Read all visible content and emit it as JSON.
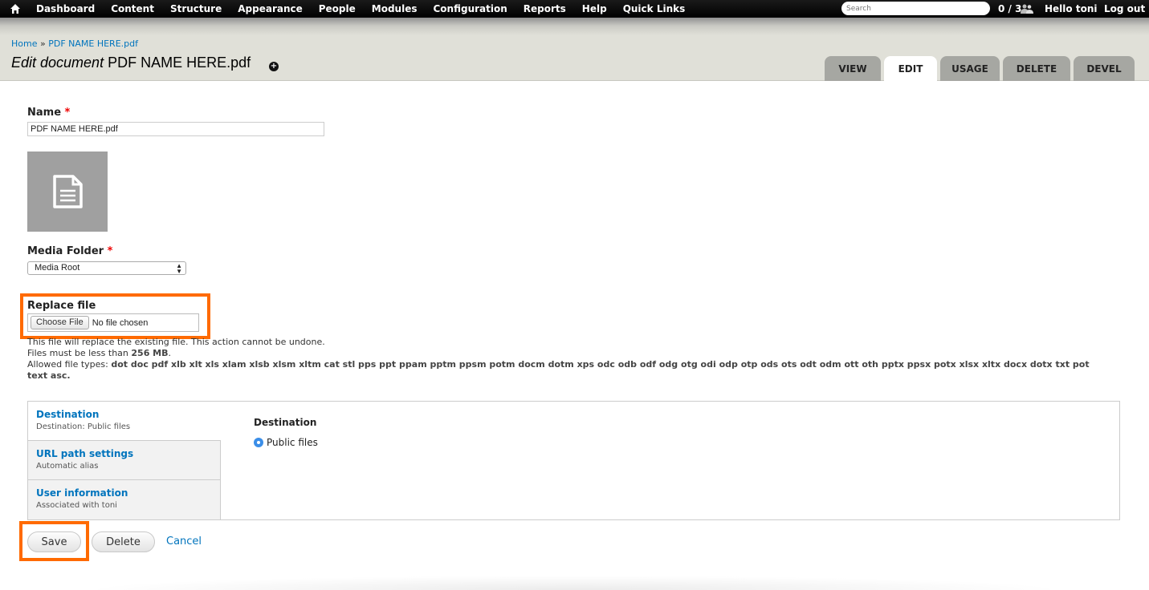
{
  "toolbar": {
    "menu": [
      "Dashboard",
      "Content",
      "Structure",
      "Appearance",
      "People",
      "Modules",
      "Configuration",
      "Reports",
      "Help",
      "Quick Links"
    ],
    "search_placeholder": "Search",
    "user_count": "0 / 3",
    "greeting": "Hello ",
    "username": "toni",
    "logout": "Log out"
  },
  "header": {
    "breadcrumb": {
      "home": "Home",
      "sep": " » ",
      "current": "PDF NAME HERE.pdf"
    },
    "title_prefix": "Edit document",
    "title_name": " PDF NAME HERE.pdf",
    "tabs": [
      "VIEW",
      "EDIT",
      "USAGE",
      "DELETE",
      "DEVEL"
    ],
    "active_tab": "EDIT"
  },
  "form": {
    "name_label": "Name",
    "required_mark": "*",
    "name_value": "PDF NAME HERE.pdf",
    "media_folder_label": "Media Folder",
    "media_folder_value": "Media Root",
    "replace_file_label": "Replace file",
    "choose_file_button": "Choose File",
    "no_file_text": "No file chosen",
    "desc_line1": "This file will replace the existing file. This action cannot be undone.",
    "desc_line2_prefix": "Files must be less than ",
    "desc_line2_size": "256 MB",
    "desc_line2_suffix": ".",
    "desc_line3_prefix": "Allowed file types: ",
    "allowed_types": "dot doc pdf xlb xlt xls xlam xlsb xlsm xltm cat stl pps ppt ppam pptm ppsm potm docm dotm xps odc odb odf odg otg odi odp otp ods ots odt odm ott oth pptx ppsx potx xlsx xltx docx dotx txt pot text asc",
    "desc_line3_suffix": "."
  },
  "vertical_tabs": {
    "items": [
      {
        "title": "Destination",
        "summary": "Destination: Public files"
      },
      {
        "title": "URL path settings",
        "summary": "Automatic alias"
      },
      {
        "title": "User information",
        "summary": "Associated with toni"
      }
    ],
    "pane": {
      "title": "Destination",
      "option": "Public files"
    }
  },
  "actions": {
    "save": "Save",
    "delete": "Delete",
    "cancel": "Cancel"
  },
  "colors": {
    "highlight": "#ff6a00",
    "link": "#0074bd",
    "radio": "#3b8ee8"
  },
  "icons": [
    "home-icon",
    "users-icon",
    "shortcut-add-icon",
    "document-icon",
    "select-arrows-icon",
    "radio-selected-icon"
  ]
}
